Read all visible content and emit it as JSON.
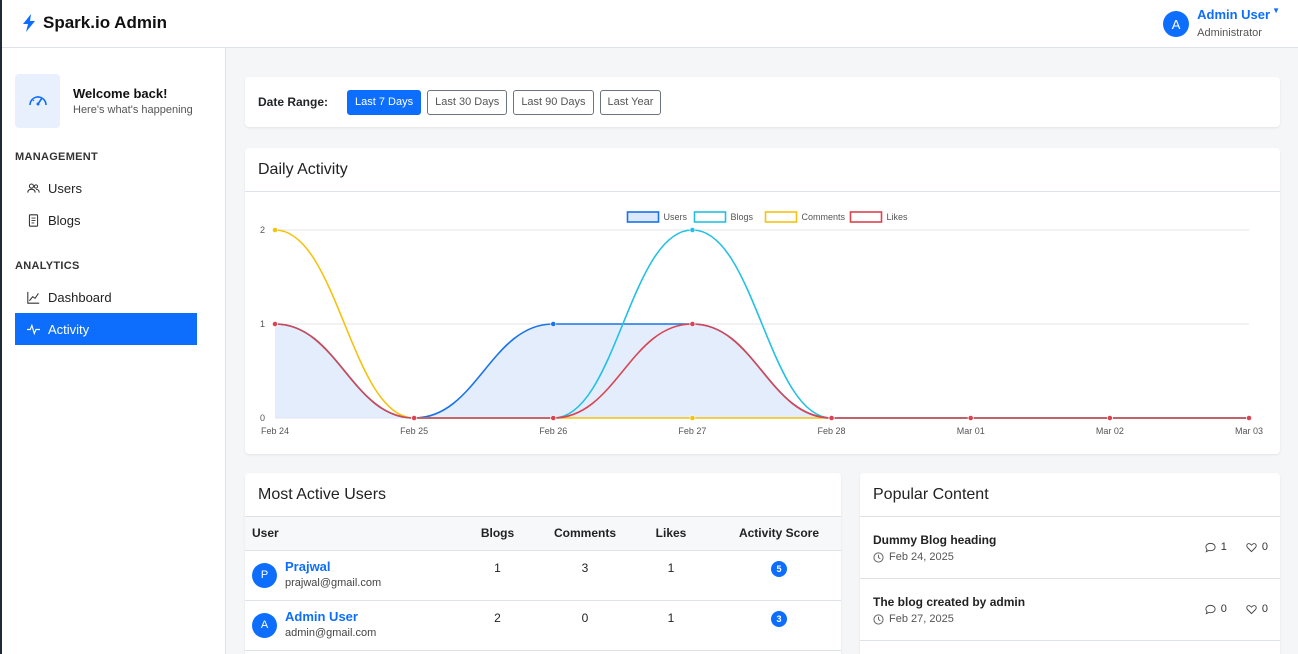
{
  "app": {
    "brand": "Spark.io Admin"
  },
  "user": {
    "name": "Admin User",
    "role": "Administrator",
    "initial": "A"
  },
  "sidebar": {
    "welcome_title": "Welcome back!",
    "welcome_sub": "Here's what's happening",
    "sections": [
      {
        "title": "MANAGEMENT",
        "items": [
          {
            "label": "Users",
            "icon": "users-icon"
          },
          {
            "label": "Blogs",
            "icon": "document-icon"
          }
        ]
      },
      {
        "title": "ANALYTICS",
        "items": [
          {
            "label": "Dashboard",
            "icon": "line-chart-icon"
          },
          {
            "label": "Activity",
            "icon": "pulse-icon",
            "active": true
          }
        ]
      }
    ]
  },
  "date_range": {
    "label": "Date Range:",
    "options": [
      "Last 7 Days",
      "Last 30 Days",
      "Last 90 Days",
      "Last Year"
    ],
    "selected": "Last 7 Days"
  },
  "chart_card": {
    "title": "Daily Activity"
  },
  "chart_data": {
    "type": "line",
    "x": [
      "Feb 24",
      "Feb 25",
      "Feb 26",
      "Feb 27",
      "Feb 28",
      "Mar 01",
      "Mar 02",
      "Mar 03"
    ],
    "ylim": [
      0,
      2
    ],
    "yticks": [
      0,
      1,
      2
    ],
    "grid": true,
    "legend_position": "top-center",
    "series": [
      {
        "name": "Users",
        "values": [
          1,
          0,
          1,
          1,
          0,
          0,
          0,
          0
        ],
        "color": "#1a73e8",
        "fill": true
      },
      {
        "name": "Blogs",
        "values": [
          1,
          0,
          0,
          2,
          0,
          0,
          0,
          0
        ],
        "color": "#22c1e3",
        "fill": false
      },
      {
        "name": "Comments",
        "values": [
          2,
          0,
          0,
          0,
          0,
          0,
          0,
          0
        ],
        "color": "#f5c211",
        "fill": false
      },
      {
        "name": "Likes",
        "values": [
          1,
          0,
          0,
          1,
          0,
          0,
          0,
          0
        ],
        "color": "#d94452",
        "fill": false
      }
    ]
  },
  "active_users": {
    "title": "Most Active Users",
    "columns": [
      "User",
      "Blogs",
      "Comments",
      "Likes",
      "Activity Score"
    ],
    "rows": [
      {
        "initial": "P",
        "name": "Prajwal",
        "email": "prajwal@gmail.com",
        "blogs": "1",
        "comments": "3",
        "likes": "1",
        "score": "5"
      },
      {
        "initial": "A",
        "name": "Admin User",
        "email": "admin@gmail.com",
        "blogs": "2",
        "comments": "0",
        "likes": "1",
        "score": "3"
      }
    ]
  },
  "popular": {
    "title": "Popular Content",
    "items": [
      {
        "title": "Dummy Blog heading",
        "date": "Feb 24, 2025",
        "comments": "1",
        "likes": "0"
      },
      {
        "title": "The blog created by admin",
        "date": "Feb 27, 2025",
        "comments": "0",
        "likes": "0"
      }
    ]
  }
}
